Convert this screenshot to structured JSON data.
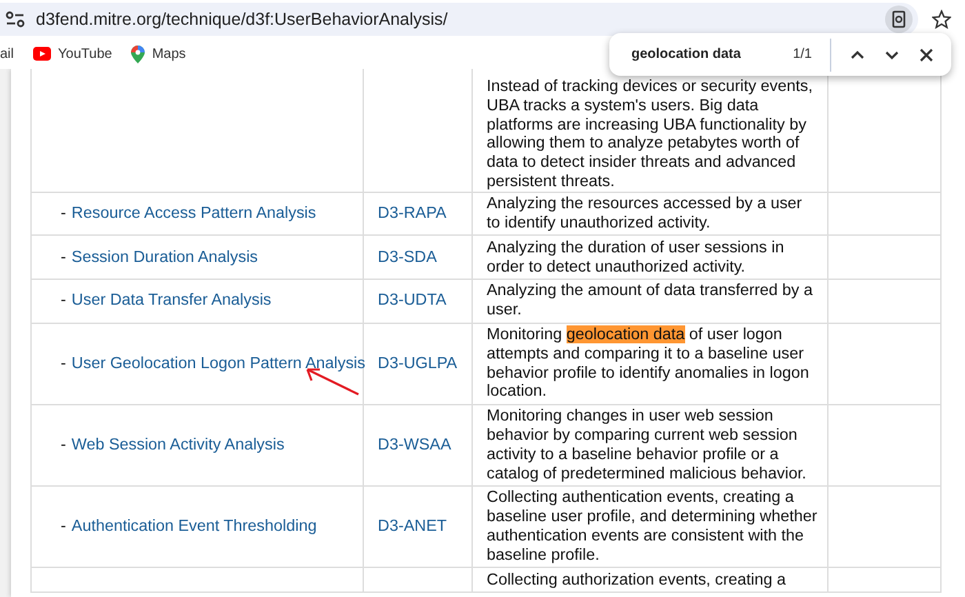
{
  "browser": {
    "url": "d3fend.mitre.org/technique/d3f:UserBehaviorAnalysis/",
    "bookmarks": [
      {
        "label": "ail",
        "kind": "mail"
      },
      {
        "label": "YouTube",
        "kind": "youtube"
      },
      {
        "label": "Maps",
        "kind": "maps"
      }
    ],
    "find": {
      "query": "geolocation data",
      "count": "1/1"
    }
  },
  "table": {
    "rows": [
      {
        "name": "",
        "id": "",
        "description": [
          {
            "text": "Instead of tracking devices or security events, UBA tracks a system's users. Big data platforms are increasing UBA functionality by allowing them to analyze petabytes worth of data to detect insider threats and advanced persistent threats.",
            "highlighted": false
          }
        ]
      },
      {
        "bullet": "-",
        "name": "Resource Access Pattern Analysis",
        "id": "D3-RAPA",
        "description": [
          {
            "text": "Analyzing the resources accessed by a user to identify unauthorized activity.",
            "highlighted": false
          }
        ]
      },
      {
        "bullet": "-",
        "name": "Session Duration Analysis",
        "id": "D3-SDA",
        "description": [
          {
            "text": "Analyzing the duration of user sessions in order to detect unauthorized activity.",
            "highlighted": false
          }
        ]
      },
      {
        "bullet": "-",
        "name": "User Data Transfer Analysis",
        "id": "D3-UDTA",
        "description": [
          {
            "text": "Analyzing the amount of data transferred by a user.",
            "highlighted": false
          }
        ]
      },
      {
        "bullet": "-",
        "name": "User Geolocation Logon Pattern Analysis",
        "id": "D3-UGLPA",
        "annotated": true,
        "description": [
          {
            "text": "Monitoring ",
            "highlighted": false
          },
          {
            "text": "geolocation data",
            "highlighted": true
          },
          {
            "text": " of user logon attempts and comparing it to a baseline user behavior profile to identify anomalies in logon location.",
            "highlighted": false
          }
        ]
      },
      {
        "bullet": "-",
        "name": "Web Session Activity Analysis",
        "id": "D3-WSAA",
        "description": [
          {
            "text": "Monitoring changes in user web session behavior by comparing current web session activity to a baseline behavior profile or a catalog of predetermined malicious behavior.",
            "highlighted": false
          }
        ]
      },
      {
        "bullet": "-",
        "name": "Authentication Event Thresholding",
        "id": "D3-ANET",
        "description": [
          {
            "text": "Collecting authentication events, creating a baseline user profile, and determining whether authentication events are consistent with the baseline profile.",
            "highlighted": false
          }
        ]
      },
      {
        "name": "",
        "id": "",
        "description": [
          {
            "text": "Collecting authorization events, creating a",
            "highlighted": false
          }
        ]
      }
    ]
  }
}
